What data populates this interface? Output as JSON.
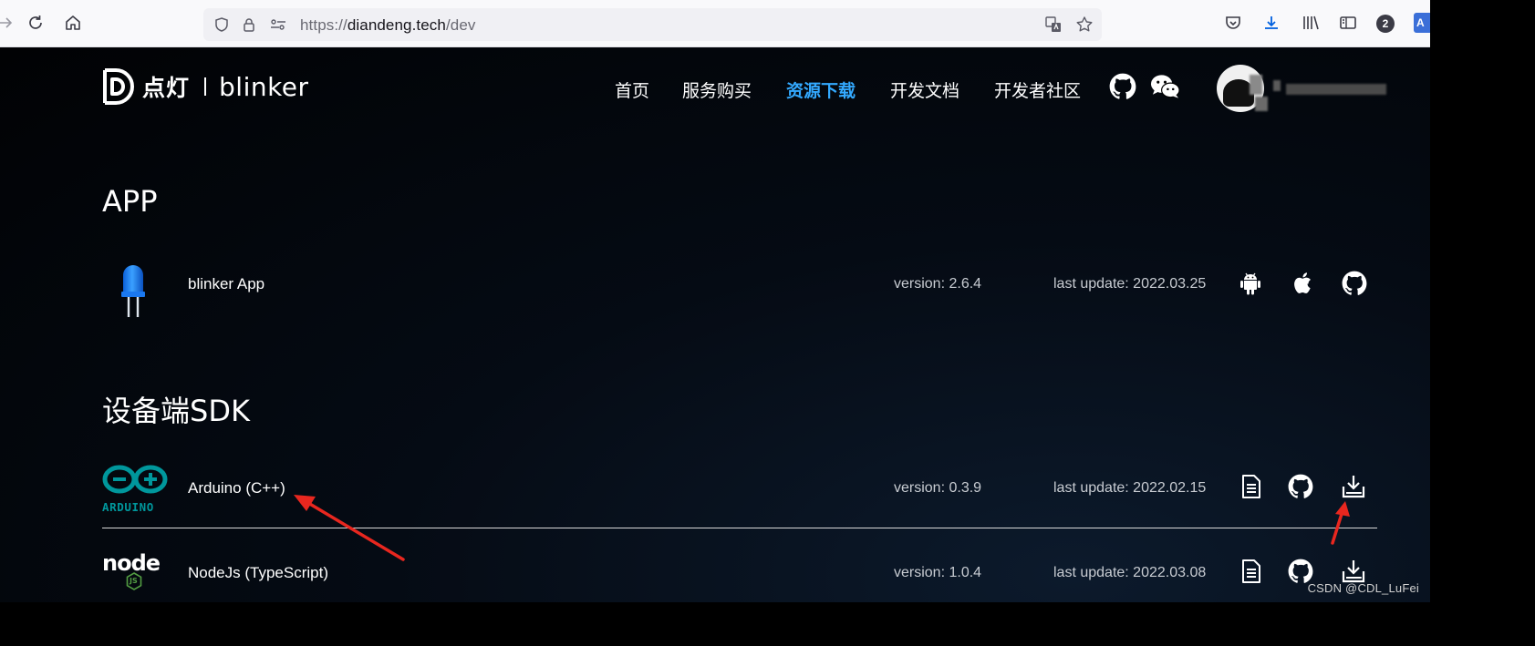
{
  "browser": {
    "url_prefix": "https://",
    "url_host": "diandeng.tech",
    "url_path": "/dev",
    "extension_badge_count": "2",
    "translate_glyph": "A"
  },
  "site": {
    "logo": {
      "cn": "点灯",
      "en": "blinker"
    },
    "nav": [
      {
        "label": "首页",
        "active": false
      },
      {
        "label": "服务购买",
        "active": false
      },
      {
        "label": "资源下载",
        "active": true
      },
      {
        "label": "开发文档",
        "active": false
      },
      {
        "label": "开发者社区",
        "active": false
      }
    ],
    "accent_color": "#33a9ff"
  },
  "sections": {
    "app": {
      "title": "APP",
      "rows": [
        {
          "name": "blinker App",
          "version": "version: 2.6.4",
          "updated": "last update: 2022.03.25",
          "actions": [
            "android-icon",
            "apple-icon",
            "github-icon"
          ]
        }
      ]
    },
    "sdk": {
      "title": "设备端SDK",
      "rows": [
        {
          "name": "Arduino (C++)",
          "logo_text": "ARDUINO",
          "version": "version: 0.3.9",
          "updated": "last update: 2022.02.15",
          "actions": [
            "document-icon",
            "github-icon",
            "download-icon"
          ]
        },
        {
          "name": "NodeJs (TypeScript)",
          "logo_text": "node",
          "logo_sub": "JS",
          "version": "version: 1.0.4",
          "updated": "last update: 2022.03.08",
          "actions": [
            "document-icon",
            "github-icon",
            "download-icon"
          ]
        }
      ]
    }
  },
  "annotation_color": "#e8271f",
  "watermark": "CSDN @CDL_LuFei"
}
